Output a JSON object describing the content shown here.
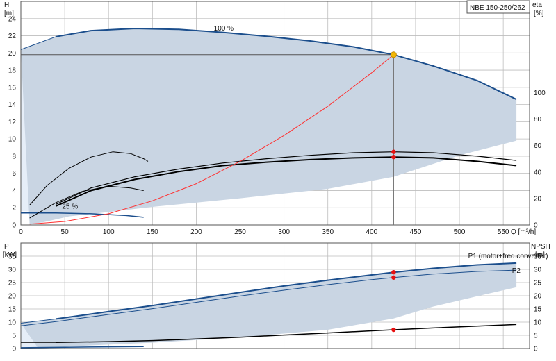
{
  "colors": {
    "band_fill": "#c9d5e3",
    "band_light": "#e6eef8",
    "curve_blue": "#1b4e8c",
    "curve_black": "#000000",
    "system_curve": "#ff3030",
    "op_point": "#f2b705",
    "marker": "#e81010",
    "grid": "#bdbdbd"
  },
  "chart_data": [
    {
      "id": "top",
      "type": "line",
      "title": "NBE 150-250/262",
      "xlabel": "Q [m³/h]",
      "ylabel_left": [
        "H",
        "[m]"
      ],
      "ylabel_right": [
        "eta",
        "[%]"
      ],
      "xlim": [
        0,
        580
      ],
      "ylim_left": [
        0,
        26
      ],
      "ylim_right": [
        0,
        169
      ],
      "x_ticks": [
        0,
        50,
        100,
        150,
        200,
        250,
        300,
        350,
        400,
        450,
        500,
        550
      ],
      "y_ticks_left": [
        0,
        2,
        4,
        6,
        8,
        10,
        12,
        14,
        16,
        18,
        20,
        22,
        24
      ],
      "y_ticks_right": [
        0,
        20,
        40,
        60,
        80,
        100
      ],
      "annotations": [
        {
          "text": "100 %",
          "x": 220,
          "y": 22.6
        },
        {
          "text": "25 %",
          "x": 47,
          "y": 1.9
        }
      ],
      "operating_point": {
        "x": 425,
        "y": 19.8
      },
      "band": {
        "upper": [
          [
            0,
            20.4
          ],
          [
            40,
            21.9
          ],
          [
            80,
            22.6
          ],
          [
            130,
            22.85
          ],
          [
            180,
            22.75
          ],
          [
            230,
            22.4
          ],
          [
            280,
            21.95
          ],
          [
            330,
            21.4
          ],
          [
            380,
            20.7
          ],
          [
            425,
            19.8
          ],
          [
            470,
            18.5
          ],
          [
            520,
            16.8
          ],
          [
            565,
            14.6
          ]
        ],
        "lower": [
          [
            565,
            9.8
          ],
          [
            500,
            8.1
          ],
          [
            425,
            5.6
          ],
          [
            350,
            4.2
          ],
          [
            250,
            3.1
          ],
          [
            150,
            2.1
          ],
          [
            100,
            1.5
          ],
          [
            55,
            1.0
          ],
          [
            25,
            0.3
          ],
          [
            10,
            0.1
          ]
        ]
      },
      "light_band": [
        [
          0,
          20.4
        ],
        [
          40,
          21.9
        ],
        [
          25,
          10
        ],
        [
          15,
          3.5
        ],
        [
          10,
          1.6
        ],
        [
          0,
          1.6
        ]
      ],
      "series": [
        {
          "role": "curve",
          "color": "curve_blue",
          "width": 2,
          "points": [
            [
              40,
              21.9
            ],
            [
              80,
              22.6
            ],
            [
              130,
              22.85
            ],
            [
              180,
              22.75
            ],
            [
              230,
              22.4
            ],
            [
              280,
              21.95
            ],
            [
              330,
              21.4
            ],
            [
              380,
              20.7
            ],
            [
              425,
              19.8
            ],
            [
              470,
              18.5
            ],
            [
              520,
              16.8
            ],
            [
              565,
              14.6
            ]
          ]
        },
        {
          "role": "curve",
          "color": "curve_blue",
          "width": 1,
          "points": [
            [
              0,
              20.4
            ],
            [
              40,
              21.9
            ]
          ]
        },
        {
          "role": "curve",
          "color": "curve_blue",
          "width": 1.5,
          "points": [
            [
              0,
              1.4
            ],
            [
              40,
              1.4
            ],
            [
              80,
              1.3
            ],
            [
              120,
              1.1
            ],
            [
              140,
              0.9
            ]
          ]
        },
        {
          "role": "curve",
          "color": "curve_black",
          "width": 1,
          "points": [
            [
              10,
              2.3
            ],
            [
              30,
              4.6
            ],
            [
              55,
              6.6
            ],
            [
              80,
              7.9
            ],
            [
              105,
              8.5
            ],
            [
              125,
              8.3
            ],
            [
              140,
              7.7
            ],
            [
              145,
              7.4
            ]
          ]
        },
        {
          "role": "curve",
          "color": "curve_black",
          "width": 1,
          "points": [
            [
              10,
              0.8
            ],
            [
              40,
              2.6
            ],
            [
              70,
              3.9
            ],
            [
              100,
              4.5
            ],
            [
              125,
              4.3
            ],
            [
              140,
              4.0
            ]
          ]
        },
        {
          "role": "curve",
          "color": "curve_black",
          "width": 1.2,
          "points": [
            [
              40,
              2.4
            ],
            [
              80,
              4.3
            ],
            [
              130,
              5.6
            ],
            [
              180,
              6.5
            ],
            [
              230,
              7.2
            ],
            [
              280,
              7.7
            ],
            [
              330,
              8.1
            ],
            [
              380,
              8.4
            ],
            [
              425,
              8.5
            ],
            [
              470,
              8.4
            ],
            [
              520,
              8.0
            ],
            [
              565,
              7.5
            ]
          ]
        },
        {
          "role": "curve",
          "color": "curve_black",
          "width": 2,
          "points": [
            [
              40,
              2.2
            ],
            [
              80,
              4.0
            ],
            [
              130,
              5.3
            ],
            [
              180,
              6.2
            ],
            [
              230,
              6.9
            ],
            [
              280,
              7.3
            ],
            [
              330,
              7.6
            ],
            [
              380,
              7.8
            ],
            [
              425,
              7.9
            ],
            [
              470,
              7.8
            ],
            [
              520,
              7.4
            ],
            [
              565,
              6.9
            ]
          ]
        },
        {
          "role": "system",
          "color": "system_curve",
          "width": 1,
          "points": [
            [
              10,
              0.1
            ],
            [
              50,
              0.4
            ],
            [
              100,
              1.3
            ],
            [
              150,
              2.8
            ],
            [
              200,
              4.8
            ],
            [
              250,
              7.4
            ],
            [
              300,
              10.4
            ],
            [
              350,
              13.8
            ],
            [
              400,
              17.7
            ],
            [
              425,
              19.8
            ]
          ]
        }
      ],
      "markers": [
        {
          "x": 425,
          "y": 8.5
        },
        {
          "x": 425,
          "y": 7.9
        }
      ]
    },
    {
      "id": "bottom",
      "type": "line",
      "xlim": [
        0,
        580
      ],
      "ylim_left": [
        0,
        40
      ],
      "ylim_right": [
        0,
        40
      ],
      "ylabel_left": [
        "P",
        "[kW]"
      ],
      "ylabel_right": [
        "NPSH",
        "[m]"
      ],
      "y_ticks_left": [
        0,
        5,
        10,
        15,
        20,
        25,
        30,
        35
      ],
      "y_ticks_right": [
        0,
        5,
        10,
        15,
        20,
        25,
        30,
        35
      ],
      "annotations": [
        {
          "text": "P1 (motor+freq.converter)",
          "x": 510,
          "y": 34.2,
          "color": "curve_blue"
        },
        {
          "text": "P2",
          "x": 560,
          "y": 28.7,
          "color": "curve_blue"
        }
      ],
      "band": {
        "upper": [
          [
            0,
            9.6
          ],
          [
            40,
            11.2
          ],
          [
            100,
            14.0
          ],
          [
            150,
            16.3
          ],
          [
            200,
            18.8
          ],
          [
            250,
            21.3
          ],
          [
            300,
            23.7
          ],
          [
            350,
            25.9
          ],
          [
            400,
            27.9
          ],
          [
            425,
            28.9
          ],
          [
            470,
            30.4
          ],
          [
            520,
            31.7
          ],
          [
            565,
            32.4
          ]
        ],
        "lower": [
          [
            565,
            23.2
          ],
          [
            520,
            19.8
          ],
          [
            470,
            15.9
          ],
          [
            425,
            11.4
          ],
          [
            350,
            7.1
          ],
          [
            250,
            4.2
          ],
          [
            150,
            2.2
          ],
          [
            60,
            0.9
          ],
          [
            30,
            0.2
          ],
          [
            20,
            0
          ]
        ]
      },
      "light_band": [
        [
          0,
          9.6
        ],
        [
          40,
          11.2
        ],
        [
          30,
          4
        ],
        [
          20,
          0.5
        ],
        [
          0,
          0.5
        ]
      ],
      "series": [
        {
          "role": "P1",
          "color": "curve_blue",
          "width": 2,
          "points": [
            [
              40,
              11.2
            ],
            [
              100,
              14.0
            ],
            [
              150,
              16.3
            ],
            [
              200,
              18.8
            ],
            [
              250,
              21.3
            ],
            [
              300,
              23.7
            ],
            [
              350,
              25.9
            ],
            [
              400,
              27.9
            ],
            [
              425,
              28.9
            ],
            [
              470,
              30.4
            ],
            [
              520,
              31.7
            ],
            [
              565,
              32.4
            ]
          ]
        },
        {
          "role": "P1",
          "color": "curve_blue",
          "width": 1,
          "points": [
            [
              0,
              9.6
            ],
            [
              40,
              11.2
            ]
          ]
        },
        {
          "role": "P2",
          "color": "curve_blue",
          "width": 1,
          "points": [
            [
              0,
              8.6
            ],
            [
              40,
              10.2
            ],
            [
              100,
              12.9
            ],
            [
              150,
              15.1
            ],
            [
              200,
              17.5
            ],
            [
              250,
              19.9
            ],
            [
              300,
              22.1
            ],
            [
              350,
              24.2
            ],
            [
              400,
              26.1
            ],
            [
              425,
              26.9
            ],
            [
              470,
              28.2
            ],
            [
              520,
              29.2
            ],
            [
              565,
              29.7
            ]
          ]
        },
        {
          "role": "NPSH",
          "color": "curve_black",
          "width": 1.5,
          "points": [
            [
              40,
              2.3
            ],
            [
              100,
              2.6
            ],
            [
              150,
              3.0
            ],
            [
              200,
              3.6
            ],
            [
              250,
              4.3
            ],
            [
              300,
              5.1
            ],
            [
              350,
              5.9
            ],
            [
              400,
              6.7
            ],
            [
              425,
              7.1
            ],
            [
              470,
              7.8
            ],
            [
              520,
              8.5
            ],
            [
              565,
              9.1
            ]
          ]
        },
        {
          "role": "NPSH",
          "color": "curve_black",
          "width": 1,
          "points": [
            [
              0,
              2.3
            ],
            [
              40,
              2.3
            ]
          ]
        },
        {
          "role": "low",
          "color": "curve_blue",
          "width": 1.5,
          "points": [
            [
              0,
              0.3
            ],
            [
              60,
              0.5
            ],
            [
              140,
              0.7
            ]
          ]
        }
      ],
      "markers": [
        {
          "x": 425,
          "y": 28.9
        },
        {
          "x": 425,
          "y": 26.9
        },
        {
          "x": 425,
          "y": 7.1
        }
      ]
    }
  ]
}
